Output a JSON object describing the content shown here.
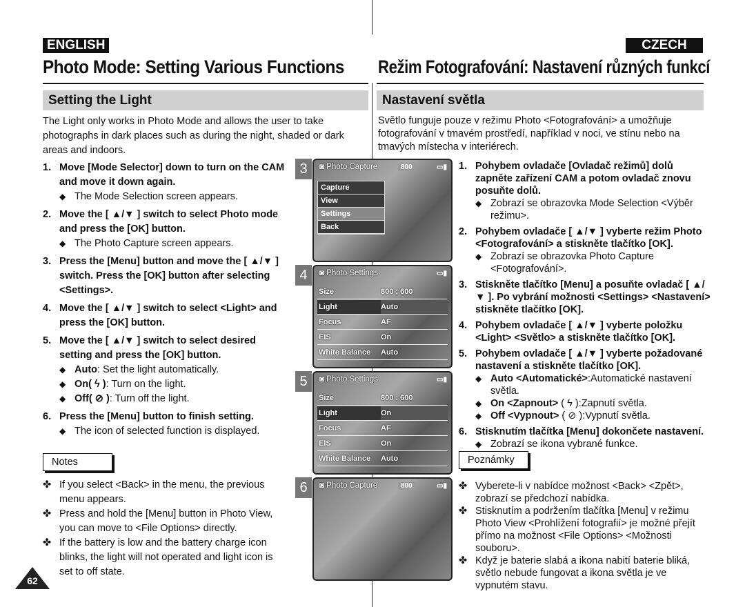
{
  "english": {
    "label": "ENGLISH",
    "title": "Photo Mode: Setting Various Functions",
    "section": "Setting the Light",
    "intro": "The Light only works in Photo Mode and allows the user to take photographs in dark places such as during the night, shaded or dark areas and indoors.",
    "steps": [
      {
        "num": "1.",
        "text": "Move [Mode Selector] down to turn on the CAM and move it down again.",
        "sub": [
          {
            "b": "",
            "t": "The Mode Selection screen appears."
          }
        ]
      },
      {
        "num": "2.",
        "text": "Move the [ ▲/▼ ] switch to select Photo mode and press the [OK] button.",
        "sub": [
          {
            "b": "",
            "t": "The Photo Capture screen appears."
          }
        ]
      },
      {
        "num": "3.",
        "text": "Press the [Menu] button and move the [ ▲/▼ ] switch. Press the [OK] button after selecting <Settings>.",
        "sub": []
      },
      {
        "num": "4.",
        "text": "Move the [ ▲/▼ ] switch to select <Light> and press the [OK] button.",
        "sub": []
      },
      {
        "num": "5.",
        "text": "Move the [ ▲/▼ ] switch to select desired setting and press the [OK] button.",
        "sub": [
          {
            "b": "Auto",
            "t": ": Set the light automatically."
          },
          {
            "b": "On( ϟ )",
            "t": ": Turn on the light."
          },
          {
            "b": "Off( ⊘ )",
            "t": ": Turn off the light."
          }
        ]
      },
      {
        "num": "6.",
        "text": "Press the [Menu] button to finish setting.",
        "sub": [
          {
            "b": "",
            "t": "The icon of selected function is displayed."
          }
        ]
      }
    ],
    "notes_label": "Notes",
    "notes": [
      "If you select <Back> in the menu, the previous menu appears.",
      "Press and hold the [Menu] button in Photo View, you can move to <File Options> directly.",
      "If the battery is low and the battery charge icon blinks, the light will not operated and light icon is set to off state."
    ],
    "page_number": "62"
  },
  "czech": {
    "label": "CZECH",
    "title": "Režim Fotografování: Nastavení různých funkcí",
    "section": "Nastavení světla",
    "intro": "Světlo funguje pouze v režimu Photo <Fotografování> a umožňuje fotografování v tmavém prostředí, například v noci, ve stínu nebo na tmavých místecha v interiérech.",
    "steps": [
      {
        "num": "1.",
        "text": "Pohybem ovladače [Ovladač režimů] dolů zapněte zařízení CAM a potom ovladač znovu posuňte dolů.",
        "sub": [
          {
            "b": "",
            "t": "Zobrazí se obrazovka Mode Selection <Výběr režimu>."
          }
        ]
      },
      {
        "num": "2.",
        "text": "Pohybem ovladače [ ▲/▼ ] vyberte režim Photo <Fotografování> a stiskněte tlačítko [OK].",
        "sub": [
          {
            "b": "",
            "t": "Zobrazí se obrazovka Photo Capture <Fotografování>."
          }
        ]
      },
      {
        "num": "3.",
        "text": "Stiskněte tlačítko [Menu] a posuňte ovladač [ ▲/▼ ]. Po vybrání možnosti <Settings> <Nastavení> stiskněte tlačítko [OK].",
        "sub": []
      },
      {
        "num": "4.",
        "text": "Pohybem ovladače [ ▲/▼ ] vyberte položku <Light> <Světlo> a stiskněte tlačítko [OK].",
        "sub": []
      },
      {
        "num": "5.",
        "text": "Pohybem ovladače [ ▲/▼ ] vyberte požadované nastavení a stiskněte tlačítko [OK].",
        "sub": [
          {
            "b": "Auto <Automatické>",
            "t": ":Automatické nastavení světla."
          },
          {
            "b": "On <Zapnout>",
            "t": " ( ϟ ):Zapnutí světla."
          },
          {
            "b": "Off <Vypnout>",
            "t": " ( ⊘ ):Vypnutí světla."
          }
        ]
      },
      {
        "num": "6.",
        "text": "Stisknutím tlačítka [Menu] dokončete nastavení.",
        "sub": [
          {
            "b": "",
            "t": "Zobrazí se ikona vybrané funkce."
          }
        ]
      }
    ],
    "notes_label": "Poznámky",
    "notes": [
      "Vyberete-li v nabídce možnost <Back> <Zpět>, zobrazí se předchozí nabídka.",
      "Stisknutím a podržením tlačítka [Menu] v režimu Photo View <Prohlížení fotografií> je možné přejít přímo na možnost <File Options> <Možnosti souboru>.",
      "Když je baterie slabá a ikona nabití baterie bliká, světlo nebude fungovat a ikona světla je ve vypnutém stavu."
    ]
  },
  "screens": [
    {
      "num": "3",
      "header": "Photo Capture",
      "res": "800",
      "menu": [
        "Capture",
        "View",
        "Settings",
        "Back"
      ],
      "selected": 2
    },
    {
      "num": "4",
      "header": "Photo Settings",
      "rows": [
        [
          "Size",
          "800 : 600"
        ],
        [
          "Light",
          "Auto"
        ],
        [
          "Focus",
          "AF"
        ],
        [
          "EIS",
          "On"
        ],
        [
          "White Balance",
          "Auto"
        ]
      ],
      "selected": 1
    },
    {
      "num": "5",
      "header": "Photo Settings",
      "rows": [
        [
          "Size",
          "800 : 600"
        ],
        [
          "Light",
          "On"
        ],
        [
          "Focus",
          "AF"
        ],
        [
          "EIS",
          "On"
        ],
        [
          "White Balance",
          "Auto"
        ]
      ],
      "selected": 1
    },
    {
      "num": "6",
      "header": "Photo Capture",
      "res": "800"
    }
  ]
}
